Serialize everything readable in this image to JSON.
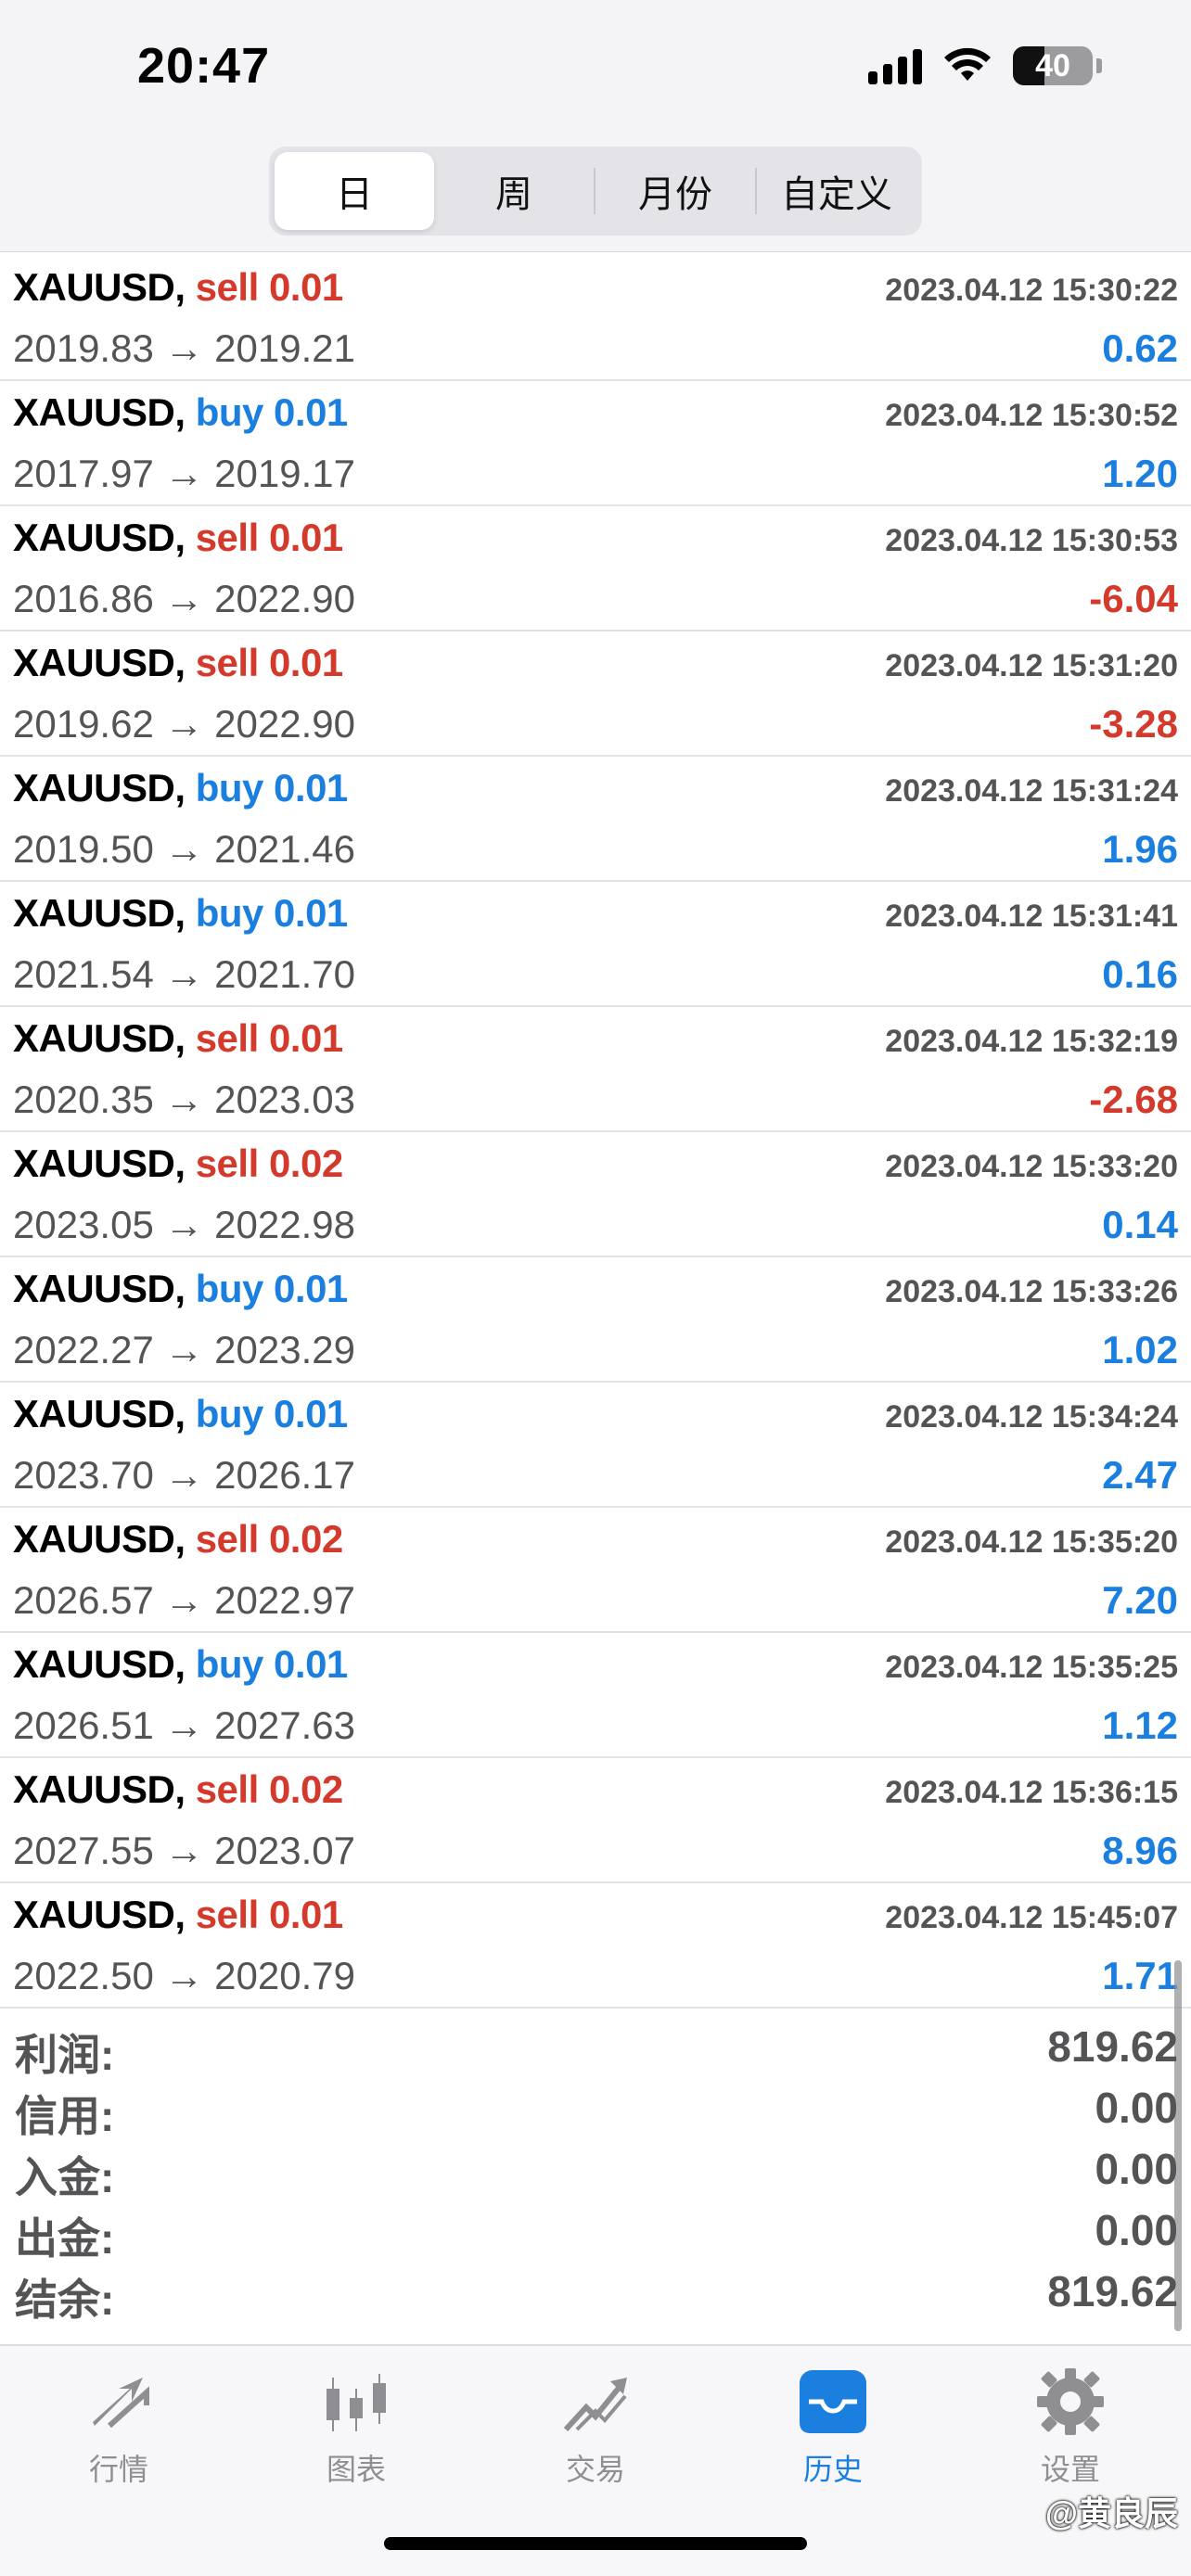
{
  "status": {
    "time": "20:47",
    "battery": "40"
  },
  "periods": [
    "日",
    "周",
    "月份",
    "自定义"
  ],
  "deals": [
    {
      "symbol": "XAUUSD,",
      "side": "sell",
      "lot": "0.01",
      "time": "2023.04.12 15:30:22",
      "prices": "2019.83 → 2019.21",
      "profit": "0.62",
      "positive": true
    },
    {
      "symbol": "XAUUSD,",
      "side": "buy",
      "lot": "0.01",
      "time": "2023.04.12 15:30:52",
      "prices": "2017.97 → 2019.17",
      "profit": "1.20",
      "positive": true
    },
    {
      "symbol": "XAUUSD,",
      "side": "sell",
      "lot": "0.01",
      "time": "2023.04.12 15:30:53",
      "prices": "2016.86 → 2022.90",
      "profit": "-6.04",
      "positive": false
    },
    {
      "symbol": "XAUUSD,",
      "side": "sell",
      "lot": "0.01",
      "time": "2023.04.12 15:31:20",
      "prices": "2019.62 → 2022.90",
      "profit": "-3.28",
      "positive": false
    },
    {
      "symbol": "XAUUSD,",
      "side": "buy",
      "lot": "0.01",
      "time": "2023.04.12 15:31:24",
      "prices": "2019.50 → 2021.46",
      "profit": "1.96",
      "positive": true
    },
    {
      "symbol": "XAUUSD,",
      "side": "buy",
      "lot": "0.01",
      "time": "2023.04.12 15:31:41",
      "prices": "2021.54 → 2021.70",
      "profit": "0.16",
      "positive": true
    },
    {
      "symbol": "XAUUSD,",
      "side": "sell",
      "lot": "0.01",
      "time": "2023.04.12 15:32:19",
      "prices": "2020.35 → 2023.03",
      "profit": "-2.68",
      "positive": false
    },
    {
      "symbol": "XAUUSD,",
      "side": "sell",
      "lot": "0.02",
      "time": "2023.04.12 15:33:20",
      "prices": "2023.05 → 2022.98",
      "profit": "0.14",
      "positive": true
    },
    {
      "symbol": "XAUUSD,",
      "side": "buy",
      "lot": "0.01",
      "time": "2023.04.12 15:33:26",
      "prices": "2022.27 → 2023.29",
      "profit": "1.02",
      "positive": true
    },
    {
      "symbol": "XAUUSD,",
      "side": "buy",
      "lot": "0.01",
      "time": "2023.04.12 15:34:24",
      "prices": "2023.70 → 2026.17",
      "profit": "2.47",
      "positive": true
    },
    {
      "symbol": "XAUUSD,",
      "side": "sell",
      "lot": "0.02",
      "time": "2023.04.12 15:35:20",
      "prices": "2026.57 → 2022.97",
      "profit": "7.20",
      "positive": true
    },
    {
      "symbol": "XAUUSD,",
      "side": "buy",
      "lot": "0.01",
      "time": "2023.04.12 15:35:25",
      "prices": "2026.51 → 2027.63",
      "profit": "1.12",
      "positive": true
    },
    {
      "symbol": "XAUUSD,",
      "side": "sell",
      "lot": "0.02",
      "time": "2023.04.12 15:36:15",
      "prices": "2027.55 → 2023.07",
      "profit": "8.96",
      "positive": true
    },
    {
      "symbol": "XAUUSD,",
      "side": "sell",
      "lot": "0.01",
      "time": "2023.04.12 15:45:07",
      "prices": "2022.50 → 2020.79",
      "profit": "1.71",
      "positive": true
    }
  ],
  "summary": [
    {
      "label": "利润:",
      "value": "819.62"
    },
    {
      "label": "信用:",
      "value": "0.00"
    },
    {
      "label": "入金:",
      "value": "0.00"
    },
    {
      "label": "出金:",
      "value": "0.00"
    },
    {
      "label": "结余:",
      "value": "819.62"
    }
  ],
  "tabs": [
    {
      "label": "行情",
      "icon": "quotes-arrows-icon"
    },
    {
      "label": "图表",
      "icon": "candlestick-chart-icon"
    },
    {
      "label": "交易",
      "icon": "trade-trend-icon"
    },
    {
      "label": "历史",
      "icon": "history-inbox-icon"
    },
    {
      "label": "设置",
      "icon": "gear-icon"
    }
  ],
  "active_tab": "历史",
  "watermark": "@黄良辰",
  "colors": {
    "sell": "#d33a2c",
    "buy": "#1b7fe0",
    "muted": "#545456",
    "tab_inactive": "#8e8e93"
  }
}
